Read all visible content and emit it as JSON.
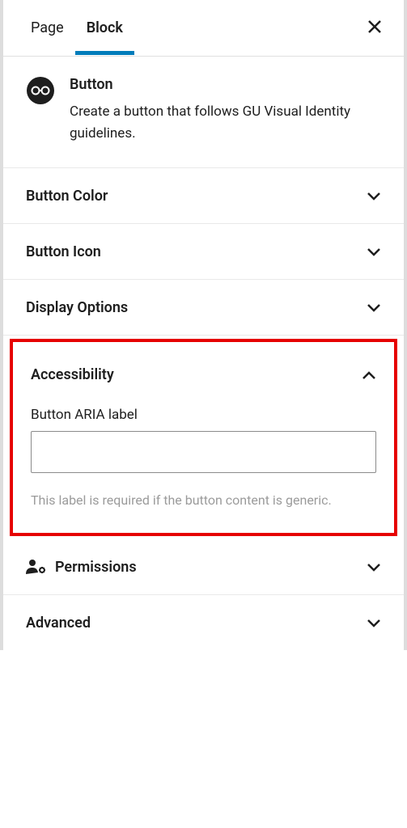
{
  "tabs": {
    "page_label": "Page",
    "block_label": "Block",
    "active": "block"
  },
  "block": {
    "title": "Button",
    "description": "Create a button that follows GU Visual Identity guidelines."
  },
  "sections": {
    "button_color": {
      "title": "Button Color",
      "expanded": false
    },
    "button_icon": {
      "title": "Button Icon",
      "expanded": false
    },
    "display_options": {
      "title": "Display Options",
      "expanded": false
    },
    "accessibility": {
      "title": "Accessibility",
      "expanded": true,
      "aria_label_field": "Button ARIA label",
      "aria_value": "",
      "help": "This label is required if the button content is generic."
    },
    "permissions": {
      "title": "Permissions",
      "expanded": false
    },
    "advanced": {
      "title": "Advanced",
      "expanded": false
    }
  }
}
